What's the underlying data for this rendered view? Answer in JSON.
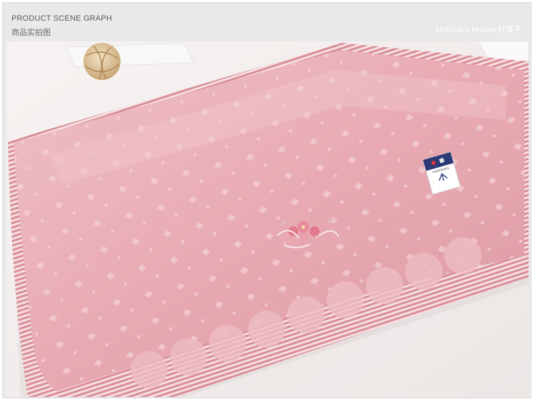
{
  "header": {
    "title_en": "PRODUCT SCENE GRAPH",
    "title_cn": "商品实拍图",
    "brand": "HOUSES House 好溪子",
    "brand_mark": "®"
  },
  "photo": {
    "label_text": "FIBERKING",
    "colors": {
      "towel": "#e8aab2",
      "towel_light": "#f0c2c8",
      "stripe": "#d98e98",
      "background": "#f4f0ef"
    }
  }
}
